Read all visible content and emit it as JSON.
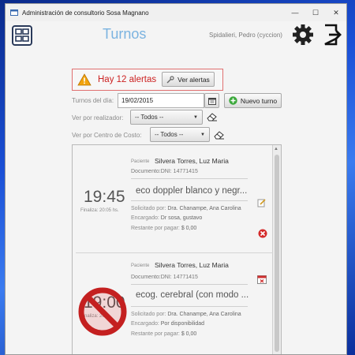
{
  "window": {
    "title": "Administración de consultorio Sosa Magnano",
    "minimize": "—",
    "maximize": "☐",
    "close": "✕"
  },
  "header": {
    "title": "Turnos",
    "user": "Spidalieri, Pedro (cyccion)"
  },
  "alerts": {
    "text": "Hay 12 alertas",
    "button": "Ver alertas"
  },
  "filters": {
    "date_label": "Turnos del día:",
    "date_value": "19/02/2015",
    "new_button": "Nuevo turno",
    "performer_label": "Ver por realizador:",
    "performer_value": "-- Todos --",
    "cost_center_label": "Ver por Centro de Costo:",
    "cost_center_value": "-- Todos --"
  },
  "appointments": [
    {
      "patient_label": "Paciente",
      "patient": "Silvera Torres, Luz Maria",
      "document": "Documento:DNI: 14771415",
      "time": "19:45",
      "finish": "Finaliza: 20:05 hs.",
      "study": "eco doppler blanco y negr...",
      "requested_label": "Solicitado por:",
      "requested": "Dra. Chanampe, Ana Carolina",
      "assigned_label": "Encargado:",
      "assigned": "Dr sosa, gustavo",
      "pending_label": "Restante por pagar:",
      "pending": "$ 0,00"
    },
    {
      "patient_label": "Paciente",
      "patient": "Silvera Torres, Luz Maria",
      "document": "Documento:DNI: 14771415",
      "time": "19:00",
      "finish": "Finaliza: 20...",
      "study": "ecog. cerebral (con modo ...",
      "requested_label": "Solicitado por:",
      "requested": "Dra. Chanampe, Ana Carolina",
      "assigned_label": "Encargado:",
      "assigned": "Por disponibilidad",
      "pending_label": "Restante por pagar:",
      "pending": "$ 0,00"
    }
  ]
}
